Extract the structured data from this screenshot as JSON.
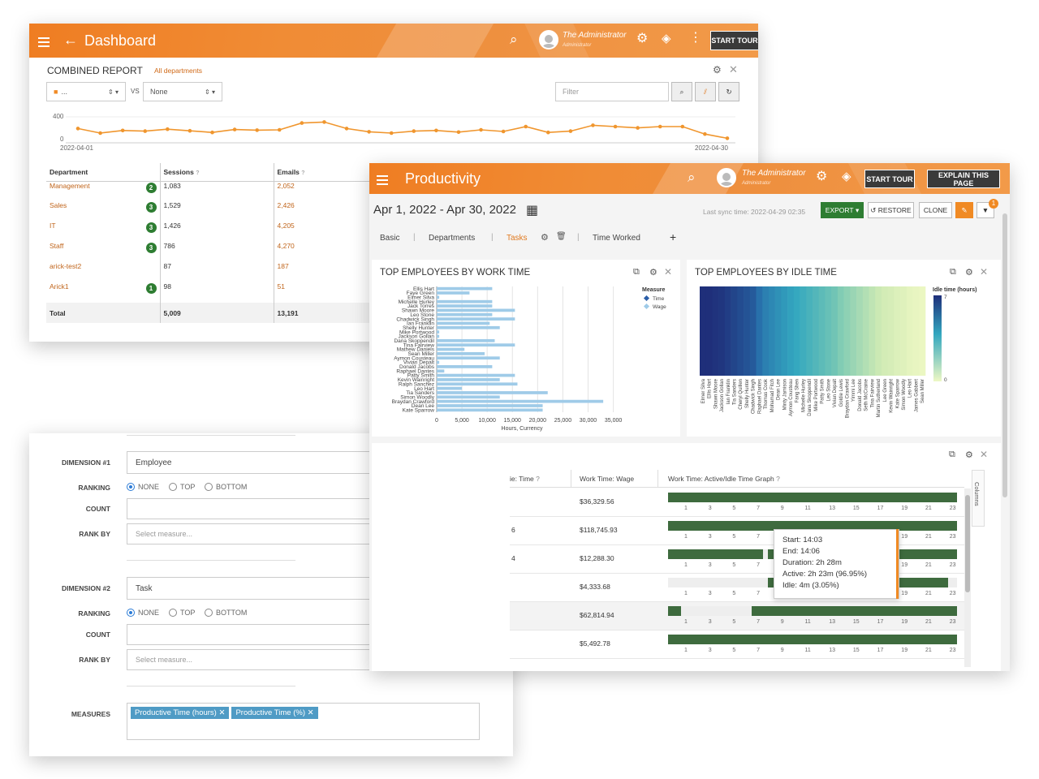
{
  "dashboard": {
    "title": "Dashboard",
    "admin_name": "The Administrator",
    "admin_role": "Administrator",
    "start_tour": "START TOUR",
    "report_title": "COMBINED REPORT",
    "report_scope": "All departments",
    "select_left": "...",
    "vs": "VS",
    "select_right": "None",
    "filter_placeholder": "Filter",
    "axis_max": "400",
    "axis_min": "0",
    "date_start": "2022-04-01",
    "date_end": "2022-04-30",
    "table": {
      "headers": [
        "Department",
        "Sessions",
        "Emails"
      ],
      "rows": [
        {
          "dept": "Management",
          "badge": "2",
          "sessions": "1,083",
          "emails": "2,052"
        },
        {
          "dept": "Sales",
          "badge": "3",
          "sessions": "1,529",
          "emails": "2,426"
        },
        {
          "dept": "IT",
          "badge": "3",
          "sessions": "1,426",
          "emails": "4,205"
        },
        {
          "dept": "Staff",
          "badge": "3",
          "sessions": "786",
          "emails": "4,270"
        },
        {
          "dept": "arick-test2",
          "badge": "",
          "sessions": "87",
          "emails": "187"
        },
        {
          "dept": "Arick1",
          "badge": "1",
          "sessions": "98",
          "emails": "51"
        }
      ],
      "total": {
        "label": "Total",
        "sessions": "5,009",
        "emails": "13,191"
      }
    }
  },
  "chart_data": [
    {
      "type": "line",
      "x": [
        "2022-04-01",
        "2022-04-02",
        "2022-04-03",
        "2022-04-04",
        "2022-04-05",
        "2022-04-06",
        "2022-04-07",
        "2022-04-08",
        "2022-04-09",
        "2022-04-10",
        "2022-04-11",
        "2022-04-12",
        "2022-04-13",
        "2022-04-14",
        "2022-04-15",
        "2022-04-16",
        "2022-04-17",
        "2022-04-18",
        "2022-04-19",
        "2022-04-20",
        "2022-04-21",
        "2022-04-22",
        "2022-04-23",
        "2022-04-24",
        "2022-04-25",
        "2022-04-26",
        "2022-04-27",
        "2022-04-28",
        "2022-04-29",
        "2022-04-30"
      ],
      "values": [
        220,
        150,
        190,
        180,
        210,
        185,
        160,
        205,
        195,
        200,
        305,
        320,
        220,
        170,
        150,
        180,
        190,
        165,
        200,
        175,
        250,
        160,
        180,
        270,
        250,
        230,
        250,
        250,
        135,
        70
      ],
      "ylim": [
        0,
        400
      ],
      "color": "#f0962e"
    },
    {
      "type": "bar",
      "title": "TOP EMPLOYEES BY WORK TIME",
      "xlabel": "Hours, Currency",
      "ticks": [
        "0",
        "5,000",
        "10,000",
        "15,000",
        "20,000",
        "25,000",
        "30,000",
        "35,000"
      ],
      "xlim": [
        0,
        37000
      ],
      "legend_title": "Measure",
      "legend": [
        "Time",
        "Wage"
      ],
      "values": [
        11000,
        6500,
        500,
        11000,
        11000,
        15500,
        11000,
        15500,
        10500,
        12500,
        500,
        500,
        11500,
        15500,
        5500,
        9500,
        12500,
        500,
        11000,
        1500,
        15500,
        12500,
        16000,
        5000,
        22000,
        12500,
        33000,
        21000,
        21000
      ],
      "color": "#9fcbe8"
    },
    {
      "type": "heatmap",
      "title": "TOP EMPLOYEES BY IDLE TIME",
      "legend_title": "Idle time (hours)",
      "range": [
        0,
        7
      ],
      "categories": [
        "Elmer Silva",
        "Ellis Hart",
        "Shawn Moore",
        "Jackson Gollan",
        "Ian Franklin",
        "Tia Sanders",
        "Cheryl Quillen",
        "Shelly Hunter",
        "Chadwick Singh",
        "Raphael Dantes",
        "Thomas Cook",
        "Mohamad Fitch",
        "Dean Lee",
        "Minty Jamison",
        "Aymon Cousteau",
        "Fang Shen",
        "Michelle Hurley",
        "Dana Skoppendil",
        "Mike Portwood",
        "Patty Smith",
        "Leo Stone",
        "Vivian Depalt",
        "Goldie Lewis",
        "Braydan Crawford",
        "Yimmi Lee",
        "Donald Jacobs",
        "Seth McCraine",
        "Tina Fairview",
        "Martin Sutherland",
        "Lee Green",
        "Kevin Wainright",
        "Kate Sparrow",
        "Simon Woodly",
        "Leo Hart",
        "James Gabbert",
        "Sean Miller"
      ],
      "values": [
        7,
        7,
        6.9,
        6.8,
        6.6,
        6.4,
        6.2,
        6,
        5.8,
        5.2,
        4.8,
        4.6,
        4.4,
        4.2,
        4,
        3.8,
        3.6,
        3.4,
        3.2,
        3,
        2.8,
        2.6,
        2.3,
        2.1,
        1.9,
        1.7,
        1.5,
        1.3,
        1.1,
        0.9,
        0.8,
        0.6,
        0.5,
        0.3,
        0.2,
        0.1
      ]
    }
  ],
  "productivity": {
    "title": "Productivity",
    "admin_name": "The Administrator",
    "admin_role": "Administrator",
    "start_tour": "START TOUR",
    "explain": "EXPLAIN THIS PAGE",
    "notif_count": "1",
    "date_range": "Apr 1, 2022 - Apr 30, 2022",
    "sync_time": "Last sync time: 2022-04-29 02:35",
    "export": "EXPORT",
    "restore": "RESTORE",
    "clone": "CLONE",
    "tabs": [
      "Basic",
      "Departments",
      "Tasks",
      "Time Worked"
    ],
    "work_panel_title": "TOP EMPLOYEES BY WORK TIME",
    "idle_panel_title": "TOP EMPLOYEES BY IDLE TIME",
    "bar_names": [
      "Ellis Hart",
      "Faye Green",
      "Elmer Silva",
      "Michelle Hurley",
      "Jack Torres",
      "Shawn Moore",
      "Leo Stone",
      "Chadwick Singh",
      "Ian Franklin",
      "Shelly Hunter",
      "Mike Portwood",
      "Jackson Gollan",
      "Dana Skoppendil",
      "Tina Fairview",
      "Mathew Daniels",
      "Sean Miller",
      "Aymon Cousteau",
      "Vivian Depalt",
      "Donald Jacobs",
      "Raphael Dantes",
      "Patty Smith",
      "Kevin Wainright",
      "Ralph Sanchez",
      "Leo Hart",
      "Tia Sanders",
      "Simon Woodly",
      "Braydan Crawford",
      "Dean Lee",
      "Kate Sparrow"
    ],
    "grid": {
      "col_time": "ie: Time",
      "col_wage": "Work Time: Wage",
      "col_graph": "Work Time: Active/Idle Time Graph",
      "columns_tab": "Columns",
      "rows": [
        {
          "time": "",
          "wage": "$36,329.56"
        },
        {
          "time": "6",
          "wage": "$118,745.93"
        },
        {
          "time": "4",
          "wage": "$12,288.30"
        },
        {
          "time": "",
          "wage": "$4,333.68"
        },
        {
          "time": "",
          "wage": "$62,814.94"
        },
        {
          "time": "",
          "wage": "$5,492.78"
        }
      ],
      "hours": [
        "1",
        "3",
        "5",
        "7",
        "9",
        "11",
        "13",
        "15",
        "17",
        "19",
        "21",
        "23"
      ],
      "tooltip": [
        "Start: 14:03",
        "End: 14:06",
        "Duration: 2h 28m",
        "Active: 2h 23m (96.95%)",
        "Idle: 4m (3.05%)"
      ]
    }
  },
  "dimensions": {
    "dim1_label": "DIMENSION #1",
    "dim1_value": "Employee",
    "dim2_label": "DIMENSION #2",
    "dim2_value": "Task",
    "ranking_label": "RANKING",
    "radio_none": "NONE",
    "radio_top": "TOP",
    "radio_bottom": "BOTTOM",
    "count_label": "COUNT",
    "rank_by_label": "RANK BY",
    "rank_by_placeholder": "Select measure...",
    "measures_label": "MEASURES",
    "measures": [
      "Productive Time (hours)",
      "Productive Time (%)"
    ]
  }
}
